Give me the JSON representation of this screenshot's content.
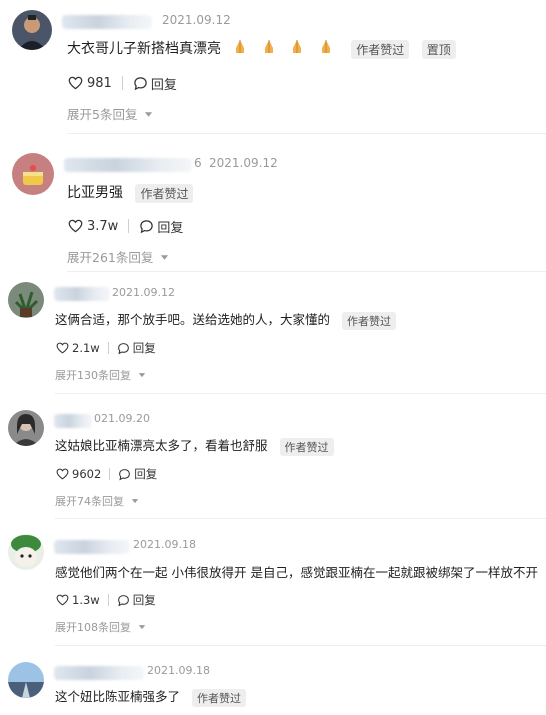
{
  "comments": [
    {
      "id": "c1",
      "date": "2021.09.12",
      "text": "大衣哥儿子新搭档真漂亮",
      "emoji_count": 4,
      "tags": [
        "作者赞过",
        "置顶"
      ],
      "likes": "981",
      "reply_label": "回复",
      "expand_label": "展开5条回复"
    },
    {
      "id": "c2",
      "name_suffix": "6",
      "date": "2021.09.12",
      "text": "比亚男强",
      "tags": [
        "作者赞过"
      ],
      "likes": "3.7w",
      "reply_label": "回复",
      "expand_label": "展开261条回复"
    },
    {
      "id": "c3",
      "date": "2021.09.12",
      "text": "这俩合适，那个放手吧。送给选她的人，大家懂的",
      "tags": [
        "作者赞过"
      ],
      "likes": "2.1w",
      "reply_label": "回复",
      "expand_label": "展开130条回复"
    },
    {
      "id": "c4",
      "date": "021.09.20",
      "text": "这姑娘比亚楠漂亮太多了，看着也舒服",
      "tags": [
        "作者赞过"
      ],
      "likes": "9602",
      "reply_label": "回复",
      "expand_label": "展开74条回复"
    },
    {
      "id": "c5",
      "date": "2021.09.18",
      "text": "感觉他们两个在一起 小伟很放得开 是自己，感觉跟亚楠在一起就跟被绑架了一样放不开",
      "tags": [],
      "likes": "1.3w",
      "reply_label": "回复",
      "expand_label": "展开108条回复"
    },
    {
      "id": "c6",
      "date": "2021.09.18",
      "text": "这个妞比陈亚楠强多了",
      "tags": [
        "作者赞过"
      ]
    }
  ],
  "icons": {
    "like": "heart-outline-icon",
    "reply": "speech-bubble-icon",
    "expand": "caret-down-icon",
    "emoji": "praying-hands-emoji-icon"
  },
  "colors": {
    "muted": "#9a9a9a",
    "tag_bg": "#eeeeee",
    "text": "#1f1f1f"
  }
}
